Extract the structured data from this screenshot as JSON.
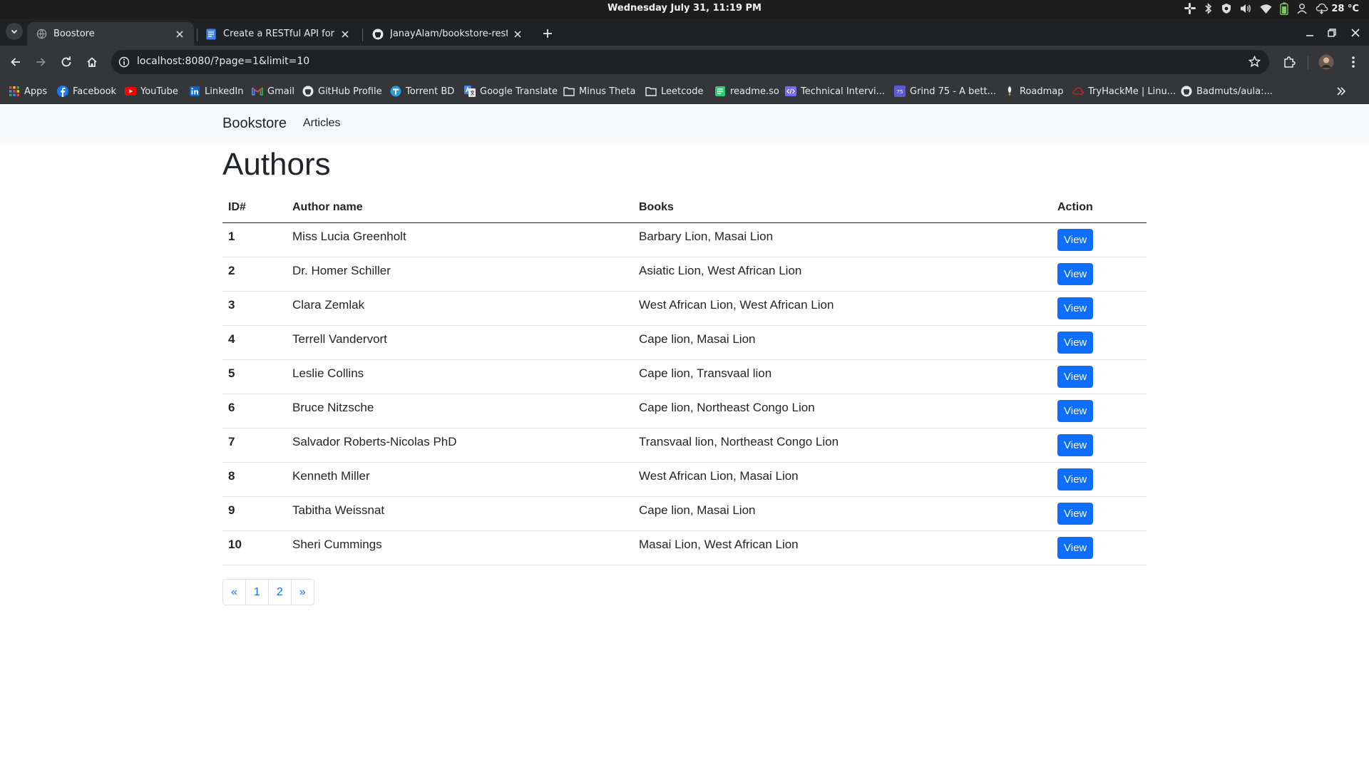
{
  "os": {
    "clock": "Wednesday July 31, 11:19 PM",
    "temperature": "28 °C",
    "tray_icons": [
      "slack-icon",
      "bluetooth-icon",
      "vpn-shield-icon",
      "volume-icon",
      "wifi-icon",
      "battery-icon",
      "user-icon",
      "weather-icon"
    ]
  },
  "browser": {
    "tabs": [
      {
        "title": "Boostore",
        "icon": "globe-icon",
        "active": true
      },
      {
        "title": "Create a RESTful API for a Bo",
        "icon": "docs-icon",
        "active": false
      },
      {
        "title": "JanayAlam/bookstore-rest",
        "icon": "github-icon",
        "active": false
      }
    ],
    "url": "localhost:8080/?page=1&limit=10",
    "bookmarks": [
      {
        "label": "Apps",
        "icon": "apps-grid-icon"
      },
      {
        "label": "Facebook",
        "icon": "facebook-icon"
      },
      {
        "label": "YouTube",
        "icon": "youtube-icon"
      },
      {
        "label": "LinkedIn",
        "icon": "linkedin-icon"
      },
      {
        "label": "Gmail",
        "icon": "gmail-icon"
      },
      {
        "label": "GitHub Profile",
        "icon": "github-icon"
      },
      {
        "label": "Torrent BD",
        "icon": "torrent-icon"
      },
      {
        "label": "Google Translate",
        "icon": "translate-icon"
      },
      {
        "label": "Minus Theta",
        "icon": "folder-icon"
      },
      {
        "label": "Leetcode",
        "icon": "folder-icon"
      },
      {
        "label": "readme.so",
        "icon": "readme-icon"
      },
      {
        "label": "Technical Intervi...",
        "icon": "code-icon"
      },
      {
        "label": "Grind 75 - A bett...",
        "icon": "grind75-icon"
      },
      {
        "label": "Roadmap",
        "icon": "roadmap-icon"
      },
      {
        "label": "TryHackMe | Linu...",
        "icon": "tryhackme-icon"
      },
      {
        "label": "Badmuts/aula:...",
        "icon": "github-icon"
      }
    ]
  },
  "site": {
    "brand": "Bookstore",
    "nav_articles": "Articles",
    "heading": "Authors",
    "columns": {
      "id": "ID#",
      "name": "Author name",
      "books": "Books",
      "action": "Action"
    },
    "rows": [
      {
        "id": "1",
        "name": "Miss Lucia Greenholt",
        "books": "Barbary Lion, Masai Lion",
        "action": "View"
      },
      {
        "id": "2",
        "name": "Dr. Homer Schiller",
        "books": "Asiatic Lion, West African Lion",
        "action": "View"
      },
      {
        "id": "3",
        "name": "Clara Zemlak",
        "books": "West African Lion, West African Lion",
        "action": "View"
      },
      {
        "id": "4",
        "name": "Terrell Vandervort",
        "books": "Cape lion, Masai Lion",
        "action": "View"
      },
      {
        "id": "5",
        "name": "Leslie Collins",
        "books": "Cape lion, Transvaal lion",
        "action": "View"
      },
      {
        "id": "6",
        "name": "Bruce Nitzsche",
        "books": "Cape lion, Northeast Congo Lion",
        "action": "View"
      },
      {
        "id": "7",
        "name": "Salvador Roberts-Nicolas PhD",
        "books": "Transvaal lion, Northeast Congo Lion",
        "action": "View"
      },
      {
        "id": "8",
        "name": "Kenneth Miller",
        "books": "West African Lion, Masai Lion",
        "action": "View"
      },
      {
        "id": "9",
        "name": "Tabitha Weissnat",
        "books": "Cape lion, Masai Lion",
        "action": "View"
      },
      {
        "id": "10",
        "name": "Sheri Cummings",
        "books": "Masai Lion, West African Lion",
        "action": "View"
      }
    ],
    "pagination": {
      "prev": "«",
      "pages": [
        "1",
        "2"
      ],
      "next": "»"
    }
  },
  "colors": {
    "accent": "#0d6efd",
    "navbar_bg": "#f8f9fa",
    "browser_dark": "#202124",
    "toolbar": "#35363a"
  }
}
